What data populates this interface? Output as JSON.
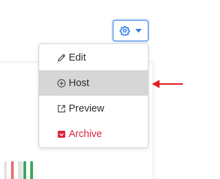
{
  "colors": {
    "accent": "#2f7be5",
    "danger": "#d9223b",
    "active_bg": "#d6d6d6",
    "annotation_arrow": "#e02020",
    "bar_grey": "#e3e3e3",
    "bar_red": "#e57373",
    "bar_green": "#3aa55d"
  },
  "toolbar": {
    "settings_icon": "gear-icon",
    "caret_icon": "caret-down-icon"
  },
  "menu": {
    "items": [
      {
        "label": "Edit",
        "icon": "pencil-icon"
      },
      {
        "label": "Host",
        "icon": "plus-circle-icon",
        "state": "hovered"
      },
      {
        "label": "Preview",
        "icon": "external-link-icon"
      },
      {
        "label": "Archive",
        "icon": "archive-icon",
        "variant": "danger"
      }
    ]
  },
  "background_bars": [
    "grey",
    "grey",
    "red",
    "grey",
    "grey",
    "green",
    "green"
  ]
}
